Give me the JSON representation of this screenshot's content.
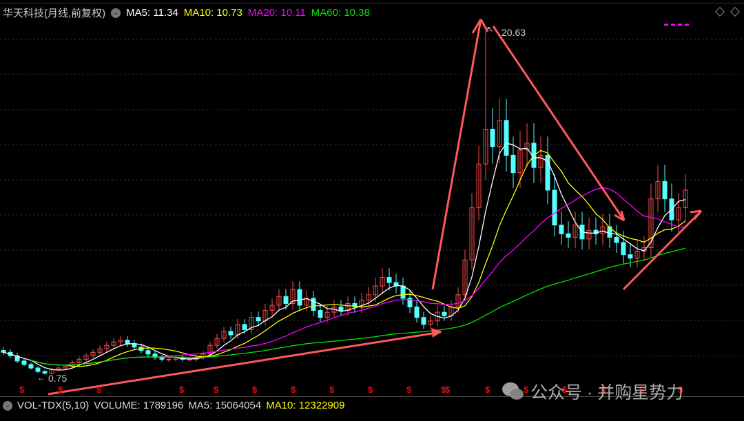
{
  "header": {
    "title": "华天科技(月线,前复权)",
    "ma5": "MA5: 11.34",
    "ma10": "MA10: 10.73",
    "ma20": "MA20: 10.11",
    "ma60": "MA60: 10.38",
    "dropdown_icon": "chevron-down-icon"
  },
  "colors": {
    "ma5": "#ffffff",
    "ma10": "#ffff00",
    "ma20": "#ff00ff",
    "ma60": "#00e600",
    "up": "#ff4a4a",
    "down": "#54ffff",
    "arrow": "#ff5a5a",
    "dividend": "#ff0000"
  },
  "annotations": {
    "high_label": "20.63",
    "low_label": "0.75"
  },
  "volume_bar": {
    "indicator": "VOL-TDX(5,10)",
    "volume": "VOLUME: 1789196",
    "ma5": "MA5: 15064054",
    "ma10": "MA10: 12322909"
  },
  "watermark": {
    "text": "公众号 · 并购星势力"
  },
  "chart_data": {
    "type": "candlestick",
    "period": "monthly",
    "price_high": 20.63,
    "price_low": 0.75,
    "ma_periods": [
      5,
      10,
      20,
      60
    ],
    "close": [
      2.2,
      2.0,
      1.7,
      1.5,
      1.3,
      1.1,
      1.0,
      1.2,
      1.3,
      1.4,
      1.6,
      1.8,
      2.0,
      2.2,
      2.4,
      2.6,
      2.8,
      2.9,
      2.7,
      2.5,
      2.3,
      2.1,
      1.9,
      1.8,
      1.8,
      1.9,
      1.8,
      1.8,
      1.9,
      2.1,
      2.6,
      3.0,
      3.4,
      3.2,
      3.8,
      3.5,
      4.2,
      4.0,
      4.6,
      4.9,
      5.4,
      5.0,
      5.8,
      4.9,
      5.3,
      4.6,
      4.2,
      4.5,
      4.8,
      4.6,
      5.0,
      4.8,
      5.2,
      5.5,
      6.0,
      6.5,
      6.2,
      6.0,
      5.3,
      4.8,
      4.2,
      3.8,
      4.0,
      4.5,
      4.3,
      4.8,
      5.5,
      7.5,
      10.5,
      13.0,
      15.0,
      14.0,
      15.5,
      13.5,
      12.5,
      13.8,
      14.2,
      12.8,
      13.5,
      11.5,
      9.5,
      9.0,
      8.8,
      9.5,
      8.7,
      9.2,
      9.0,
      9.4,
      8.8,
      8.5,
      7.8,
      7.6,
      8.0,
      8.2,
      11.0,
      12.0,
      11.0,
      9.8,
      10.5,
      11.5
    ]
  }
}
